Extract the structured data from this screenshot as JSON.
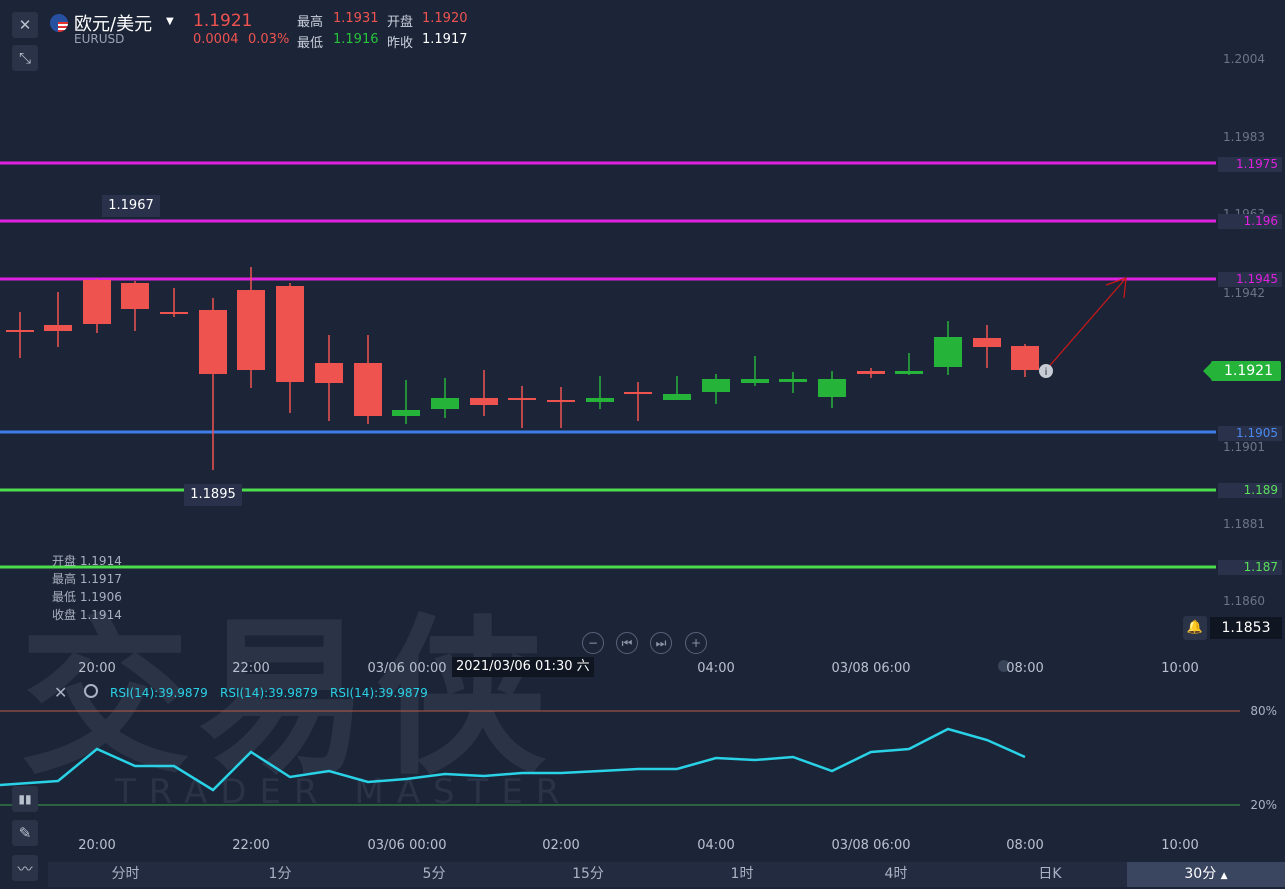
{
  "header": {
    "pair_name": "欧元/美元",
    "pair_code": "EURUSD",
    "last_price": "1.1921",
    "change": "0.0004",
    "change_pct": "0.03%",
    "high_label": "最高",
    "high_value": "1.1931",
    "open_label": "开盘",
    "open_value": "1.1920",
    "low_label": "最低",
    "low_value": "1.1916",
    "prev_close_label": "昨收",
    "prev_close_value": "1.1917"
  },
  "price_axis": {
    "ticks": [
      "1.2004",
      "1.1983",
      "1.1963",
      "1.1942",
      "1.1901",
      "1.1881",
      "1.1860"
    ],
    "current_price": "1.1921",
    "alert_price": "1.1853"
  },
  "levels": [
    {
      "label": "1.1975",
      "color": "#e020e0"
    },
    {
      "label": "1.196",
      "color": "#e020e0"
    },
    {
      "label": "1.1945",
      "color": "#e020e0"
    },
    {
      "label": "1.1905",
      "color": "#3d7be8"
    },
    {
      "label": "1.189",
      "color": "#4cdc4c"
    },
    {
      "label": "1.187",
      "color": "#4cdc4c"
    }
  ],
  "annotations": {
    "high_marker": "1.1967",
    "low_marker": "1.1895"
  },
  "ohlc_readout": [
    {
      "label": "开盘",
      "value": "1.1914"
    },
    {
      "label": "最高",
      "value": "1.1917"
    },
    {
      "label": "最低",
      "value": "1.1906"
    },
    {
      "label": "收盘",
      "value": "1.1914"
    }
  ],
  "time_axis": {
    "labels": [
      "20:00",
      "22:00",
      "03/06 00:00",
      "02:00",
      "04:00",
      "03/08 06:00",
      "08:00",
      "10:00"
    ],
    "crosshair_time": "2021/03/06 01:30 六"
  },
  "watermark": {
    "brand_cn": "交易侠",
    "brand_en": "TRADER MASTER"
  },
  "rsi": {
    "labels": [
      "RSI(14):39.9879",
      "RSI(14):39.9879",
      "RSI(14):39.9879"
    ],
    "upper": "80%",
    "lower": "20%",
    "color": "#29d2e6"
  },
  "timeframe_tabs": [
    "分时",
    "1分",
    "5分",
    "15分",
    "1时",
    "4时",
    "日K",
    "30分"
  ],
  "active_tab": "30分",
  "colors": {
    "up": "#26b33a",
    "down": "#ef5350",
    "background": "#1c2437"
  }
}
